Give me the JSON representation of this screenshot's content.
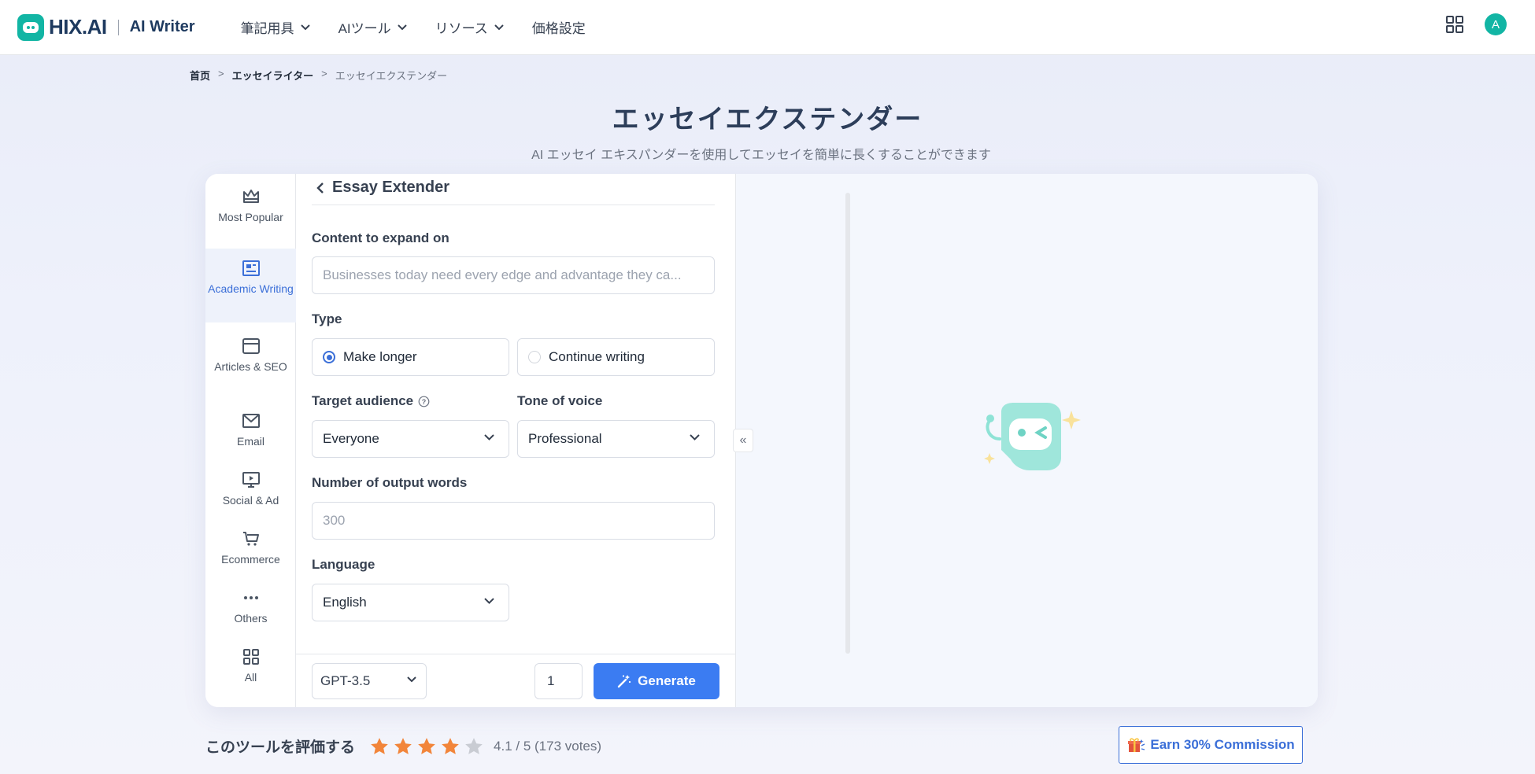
{
  "header": {
    "logo_text": "HIX.AI",
    "product_name": "AI Writer",
    "nav": [
      {
        "label": "筆記用具"
      },
      {
        "label": "AIツール"
      },
      {
        "label": "リソース"
      },
      {
        "label": "価格設定"
      }
    ],
    "avatar_initial": "A",
    "brand_color": "#12b5a4"
  },
  "breadcrumb": {
    "home": "首页",
    "parent": "エッセイライター",
    "current": "エッセイエクステンダー",
    "separator": ">"
  },
  "page": {
    "title": "エッセイエクステンダー",
    "subtitle": "AI エッセイ エキスパンダーを使用してエッセイを簡単に長くすることができます"
  },
  "categories": [
    {
      "label": "Most Popular",
      "icon": "crown-icon"
    },
    {
      "label": "Academic Writing",
      "icon": "newspaper-icon",
      "active": true
    },
    {
      "label": "Articles & SEO",
      "icon": "browser-icon"
    },
    {
      "label": "Email",
      "icon": "mail-icon"
    },
    {
      "label": "Social & Ad",
      "icon": "monitor-play-icon"
    },
    {
      "label": "Ecommerce",
      "icon": "cart-icon"
    },
    {
      "label": "Others",
      "icon": "more-icon"
    },
    {
      "label": "All",
      "icon": "grid-icon"
    }
  ],
  "form": {
    "tool_title": "Essay Extender",
    "content_label": "Content to expand on",
    "content_placeholder": "Businesses today need every edge and advantage they ca...",
    "type_label": "Type",
    "type_options": [
      {
        "label": "Make longer",
        "selected": true
      },
      {
        "label": "Continue writing",
        "selected": false
      }
    ],
    "audience_label": "Target audience",
    "audience_value": "Everyone",
    "tone_label": "Tone of voice",
    "tone_value": "Professional",
    "words_label": "Number of output words",
    "words_placeholder": "300",
    "language_label": "Language",
    "language_value": "English"
  },
  "footer": {
    "model": "GPT-3.5",
    "count": "1",
    "generate_label": "Generate",
    "accent_color": "#3b7cf2"
  },
  "rating": {
    "title": "このツールを評価する",
    "score": 4.1,
    "text": "4.1 / 5 (173 votes)"
  },
  "earn": {
    "label": "Earn 30% Commission"
  }
}
